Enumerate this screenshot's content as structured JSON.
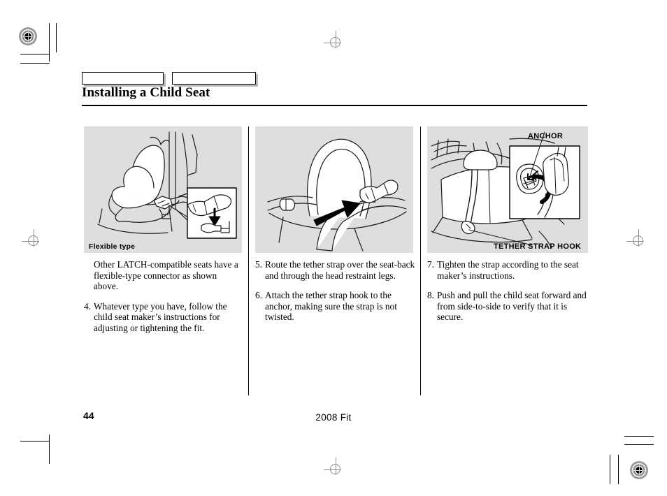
{
  "document": {
    "title": "Installing a Child Seat",
    "page_number": "44",
    "footer_model": "2008  Fit"
  },
  "header_tabs": [
    {
      "label": ""
    },
    {
      "label": ""
    }
  ],
  "panels": [
    {
      "id": "panel-flexible-type",
      "caption": "Flexible type",
      "illustration": "child-seat-with-flexible-latch-connector",
      "inset": "flexible-connector-detail-with-down-arrow"
    },
    {
      "id": "panel-tether-routing",
      "caption": "",
      "illustration": "tether-strap-routed-over-seat-back-through-head-restraint-legs"
    },
    {
      "id": "panel-anchor",
      "caption": "",
      "illustration": "rear-cargo-area-anchor-with-tether-strap-hook",
      "callouts": [
        {
          "name": "anchor",
          "label": "ANCHOR"
        },
        {
          "name": "tether-strap-hook",
          "label": "TETHER STRAP HOOK"
        }
      ]
    }
  ],
  "columns": [
    {
      "id": "column-left",
      "paragraphs": [
        {
          "number": "",
          "text": "Other LATCH-compatible seats have a flexible-type connector as shown above."
        },
        {
          "number": "4.",
          "text": "Whatever type you have, follow the child seat maker’s instructions for adjusting or tightening the fit."
        }
      ]
    },
    {
      "id": "column-middle",
      "paragraphs": [
        {
          "number": "5.",
          "text": "Route the tether strap over the seat-back and through the head restraint legs."
        },
        {
          "number": "6.",
          "text": "Attach the tether strap hook to the anchor, making sure the strap is not twisted."
        }
      ]
    },
    {
      "id": "column-right",
      "paragraphs": [
        {
          "number": "7.",
          "text": "Tighten the strap according to the seat maker’s instructions."
        },
        {
          "number": "8.",
          "text": "Push and pull the child seat forward and from side-to-side to verify that it is secure."
        }
      ]
    }
  ],
  "colors": {
    "panel_background": "#dedede",
    "ink": "#000000",
    "registration_mark": "#8d8d8d",
    "tab_shadow": "#b9b9b9"
  }
}
